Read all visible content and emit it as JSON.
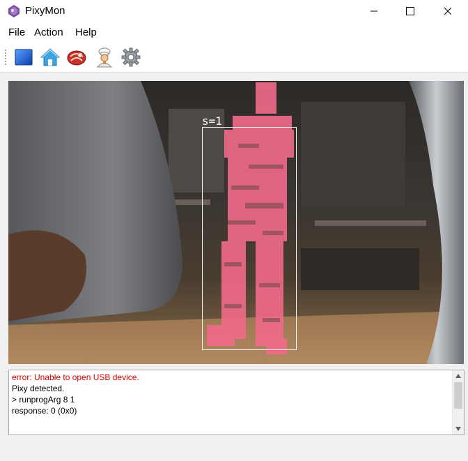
{
  "window": {
    "title": "PixyMon",
    "app_icon": "pixy-purple-icon",
    "controls": [
      "minimize-icon",
      "maximize-icon",
      "close-icon"
    ]
  },
  "menu": {
    "items": [
      "File",
      "Action",
      "Help"
    ]
  },
  "toolbar": {
    "buttons": [
      {
        "icon": "blue-square-icon",
        "name": "raw-video"
      },
      {
        "icon": "home-icon",
        "name": "default-program"
      },
      {
        "icon": "meat-steak-icon",
        "name": "set-signature"
      },
      {
        "icon": "chef-icon",
        "name": "cooked-mode"
      },
      {
        "icon": "gear-icon",
        "name": "configure"
      }
    ]
  },
  "video": {
    "detection_label": "s=1",
    "highlight_color": "#f26a8a"
  },
  "console": {
    "lines": [
      {
        "text": "error: Unable to open USB device.",
        "type": "error"
      },
      {
        "text": "Pixy detected.",
        "type": "info"
      },
      {
        "text": "> runprogArg 8 1",
        "type": "info"
      },
      {
        "text": "response: 0 (0x0)",
        "type": "info"
      }
    ],
    "error_color": "#d40000"
  }
}
